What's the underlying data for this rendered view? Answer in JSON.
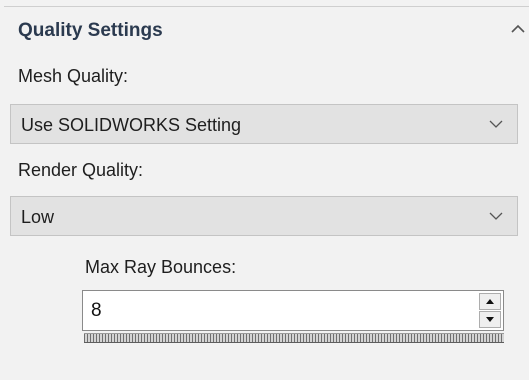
{
  "panel": {
    "section_title": "Quality Settings",
    "collapse_icon": "chevron-up-icon"
  },
  "mesh_quality": {
    "label": "Mesh Quality:",
    "selected": "Use SOLIDWORKS Setting",
    "icon": "chevron-down-icon"
  },
  "render_quality": {
    "label": "Render Quality:",
    "selected": "Low",
    "icon": "chevron-down-icon"
  },
  "max_ray_bounces": {
    "label": "Max Ray Bounces:",
    "value": "8",
    "icons": [
      "spin-up-arrow-icon",
      "spin-down-arrow-icon"
    ]
  },
  "colors": {
    "title": "#2b3a4f",
    "panel_bg": "#f2f2f2",
    "dropdown_bg": "#e2e2e2"
  }
}
